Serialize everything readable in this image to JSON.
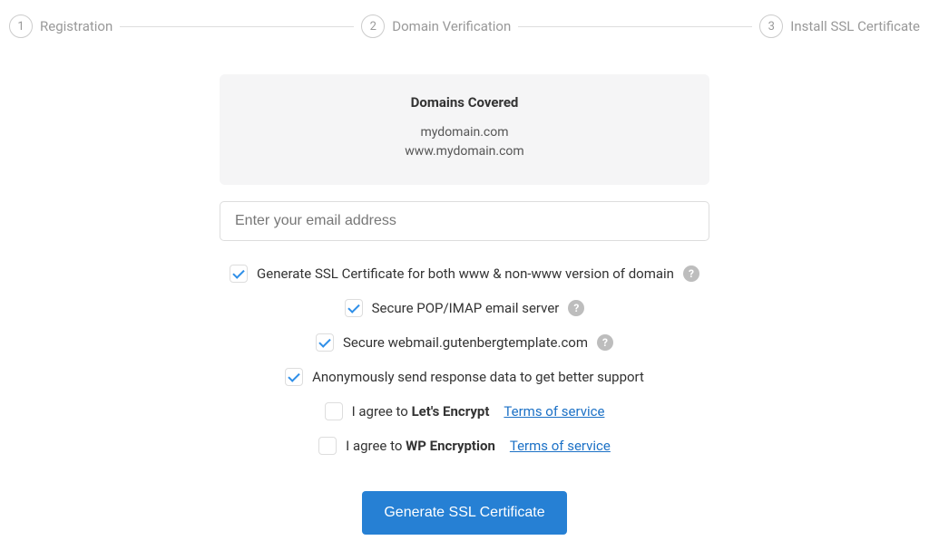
{
  "stepper": {
    "steps": [
      {
        "num": "1",
        "label": "Registration"
      },
      {
        "num": "2",
        "label": "Domain Verification"
      },
      {
        "num": "3",
        "label": "Install SSL Certificate"
      }
    ]
  },
  "domains_card": {
    "title": "Domains Covered",
    "domains": [
      "mydomain.com",
      "www.mydomain.com"
    ]
  },
  "email": {
    "placeholder": "Enter your email address",
    "value": ""
  },
  "options": {
    "www_both": {
      "checked": true,
      "label": "Generate SSL Certificate for both www & non-www version of domain",
      "help": true
    },
    "pop_imap": {
      "checked": true,
      "label": "Secure POP/IMAP email server",
      "help": true
    },
    "webmail": {
      "checked": true,
      "label": "Secure webmail.gutenbergtemplate.com",
      "help": true
    },
    "anon": {
      "checked": true,
      "label": "Anonymously send response data to get better support",
      "help": false
    },
    "le_agree": {
      "checked": false,
      "prefix": "I agree to ",
      "bold": "Let's Encrypt",
      "tos": "Terms of service"
    },
    "wpe_agree": {
      "checked": false,
      "prefix": "I agree to ",
      "bold": "WP Encryption",
      "tos": "Terms of service"
    }
  },
  "submit": {
    "label": "Generate SSL Certificate"
  }
}
